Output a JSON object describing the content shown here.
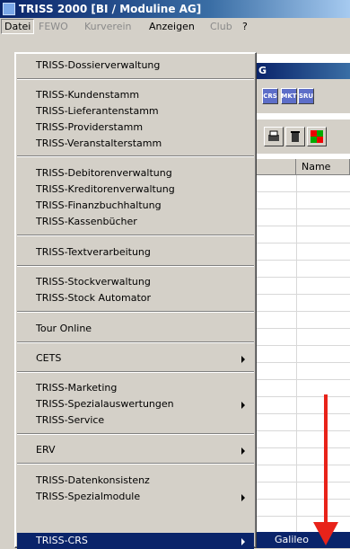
{
  "window": {
    "title": "TRISS 2000 [BI / Moduline AG]"
  },
  "menubar": [
    {
      "label": "Datei",
      "state": "active"
    },
    {
      "label": "FEWO",
      "state": "disabled"
    },
    {
      "label": "Kurverein",
      "state": "disabled"
    },
    {
      "label": "Anzeigen",
      "state": "normal"
    },
    {
      "label": "Club",
      "state": "disabled"
    },
    {
      "label": "?",
      "state": "normal"
    }
  ],
  "background": {
    "title_fragment": "G",
    "toolbar_buttons": [
      "CRS",
      "MKT",
      "SRU"
    ],
    "grid_header": "Name"
  },
  "dropdown": {
    "items": [
      {
        "label": "TRISS-Dossierverwaltung"
      },
      {
        "label": "TRISS-Kundenstamm"
      },
      {
        "label": "TRISS-Lieferantenstamm"
      },
      {
        "label": "TRISS-Providerstamm"
      },
      {
        "label": "TRISS-Veranstalterstamm"
      },
      {
        "label": "TRISS-Debitorenverwaltung"
      },
      {
        "label": "TRISS-Kreditorenverwaltung"
      },
      {
        "label": "TRISS-Finanzbuchhaltung"
      },
      {
        "label": "TRISS-Kassenbücher"
      },
      {
        "label": "TRISS-Textverarbeitung"
      },
      {
        "label": "TRISS-Stockverwaltung"
      },
      {
        "label": "TRISS-Stock Automator"
      },
      {
        "label": "Tour Online"
      },
      {
        "label": "CETS",
        "submenu": true
      },
      {
        "label": "TRISS-Marketing"
      },
      {
        "label": "TRISS-Spezialauswertungen",
        "submenu": true
      },
      {
        "label": "TRISS-Service"
      },
      {
        "label": "ERV",
        "submenu": true
      },
      {
        "label": "TRISS-Datenkonsistenz"
      },
      {
        "label": "TRISS-Spezialmodule",
        "submenu": true
      },
      {
        "label": "TRISS-CRS",
        "submenu": true,
        "selected": true
      }
    ]
  },
  "submenu": {
    "items": [
      {
        "label": "Galileo"
      }
    ]
  },
  "annotation": {
    "color": "#e8231a"
  }
}
